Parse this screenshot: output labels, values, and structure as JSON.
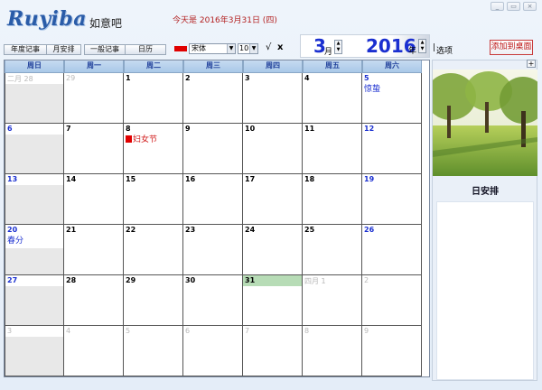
{
  "window": {
    "buttons": [
      "_",
      "▭",
      "×"
    ]
  },
  "app": {
    "logo_text": "Ruyiba",
    "slogan": "如意吧",
    "today_text": "今天是 2016年3月31日 (四)"
  },
  "view_buttons": [
    "年度记事",
    "月安排",
    "一般记事",
    "日历"
  ],
  "format_toolbar": {
    "color": "#e00000",
    "font_value": "宋体",
    "size_value": "10",
    "confirm_glyph": "√",
    "cancel_glyph": "x"
  },
  "date_selector": {
    "month": "3",
    "month_unit": "月",
    "year": "2016",
    "year_unit": "年",
    "separator": "|",
    "options_label": "选项"
  },
  "add_to_desktop_label": "添加到桌面",
  "calendar": {
    "weekdays": [
      "周日",
      "周一",
      "周二",
      "周三",
      "周四",
      "周五",
      "周六"
    ],
    "weeks": [
      [
        {
          "d": "二月 28",
          "o": 1
        },
        {
          "d": "29",
          "o": 1
        },
        {
          "d": "1"
        },
        {
          "d": "2"
        },
        {
          "d": "3"
        },
        {
          "d": "4"
        },
        {
          "d": "5",
          "f": "惊蛰",
          "fc": "blue"
        }
      ],
      [
        {
          "d": "6"
        },
        {
          "d": "7"
        },
        {
          "d": "8",
          "f": "妇女节",
          "fc": "red",
          "sq": 1
        },
        {
          "d": "9"
        },
        {
          "d": "10"
        },
        {
          "d": "11"
        },
        {
          "d": "12"
        }
      ],
      [
        {
          "d": "13"
        },
        {
          "d": "14"
        },
        {
          "d": "15"
        },
        {
          "d": "16"
        },
        {
          "d": "17"
        },
        {
          "d": "18"
        },
        {
          "d": "19"
        }
      ],
      [
        {
          "d": "20",
          "f": "春分",
          "fc": "blue"
        },
        {
          "d": "21"
        },
        {
          "d": "22"
        },
        {
          "d": "23"
        },
        {
          "d": "24"
        },
        {
          "d": "25"
        },
        {
          "d": "26"
        }
      ],
      [
        {
          "d": "27"
        },
        {
          "d": "28"
        },
        {
          "d": "29"
        },
        {
          "d": "30"
        },
        {
          "d": "31",
          "t": 1
        },
        {
          "d": "四月 1",
          "o": 1
        },
        {
          "d": "2",
          "o": 1
        }
      ],
      [
        {
          "d": "3",
          "o": 1
        },
        {
          "d": "4",
          "o": 1
        },
        {
          "d": "5",
          "o": 1
        },
        {
          "d": "6",
          "o": 1
        },
        {
          "d": "7",
          "o": 1
        },
        {
          "d": "8",
          "o": 1
        },
        {
          "d": "9",
          "o": 1
        }
      ]
    ]
  },
  "right_panel": {
    "plus_label": "+",
    "day_schedule_title": "日安排"
  }
}
